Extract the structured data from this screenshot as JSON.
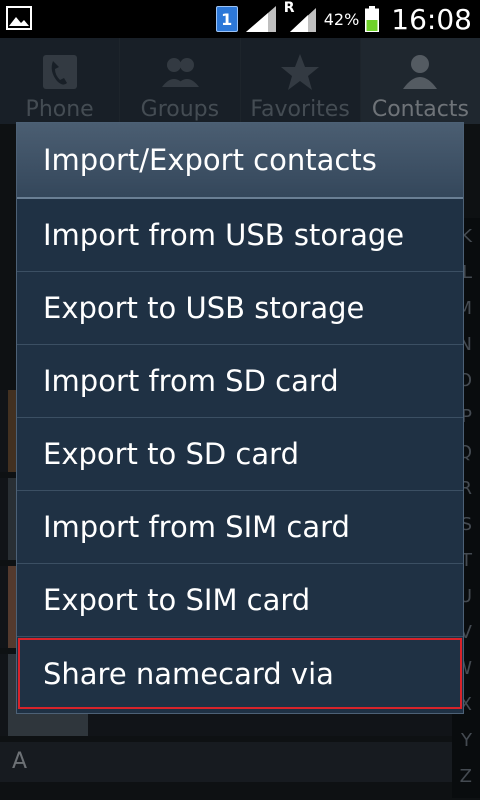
{
  "status_bar": {
    "sim_number": "1",
    "roaming_indicator": "R",
    "battery_percent": "42%",
    "time": "16:08",
    "icons": [
      "gallery-notification-icon",
      "sim-badge-icon",
      "signal-icon",
      "signal-roaming-icon",
      "battery-icon"
    ]
  },
  "tabs": [
    {
      "label": "Phone",
      "icon": "phone-icon"
    },
    {
      "label": "Groups",
      "icon": "groups-icon"
    },
    {
      "label": "Favorites",
      "icon": "star-icon"
    },
    {
      "label": "Contacts",
      "icon": "contact-icon"
    }
  ],
  "background": {
    "section_letter": "A",
    "index_letters": [
      "K",
      "L",
      "M",
      "N",
      "O",
      "P",
      "Q",
      "R",
      "S",
      "T",
      "U",
      "V",
      "W",
      "X",
      "Y",
      "Z"
    ]
  },
  "menu": {
    "title": "Import/Export contacts",
    "items": [
      "Import from USB storage",
      "Export to USB storage",
      "Import from SD card",
      "Export to SD card",
      "Import from SIM card",
      "Export to SIM card",
      "Share namecard via"
    ],
    "highlighted_index": 6
  },
  "colors": {
    "menu_bg": "#1f3144",
    "highlight_outline": "#d8232a",
    "battery_fill": "#6fd22a"
  }
}
